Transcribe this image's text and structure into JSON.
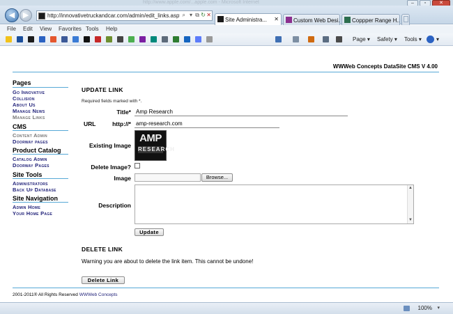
{
  "browser": {
    "faded_title": "http://www.apple.com/...apple.com - Microsoft Internet",
    "address_url": "http://innovativetruckandcar.com/admin/edit_links.asp?l",
    "tabs": [
      {
        "label": "Site Administra...",
        "active": true
      },
      {
        "label": "Custom Web Desi...",
        "active": false
      },
      {
        "label": "Coppper Range H...",
        "active": false
      }
    ],
    "menu": [
      "File",
      "Edit",
      "View",
      "Favorites",
      "Tools",
      "Help"
    ],
    "commands": {
      "page": "Page",
      "safety": "Safety",
      "tools": "Tools"
    },
    "zoom": "100%"
  },
  "header": {
    "cms_title": "WWWeb Concepts DataSite CMS V 4.00"
  },
  "sidebar": {
    "pages_heading": "Pages",
    "pages_links": [
      "Go Innovative",
      "Collision",
      "About Us",
      "Manage News",
      "Manage Links"
    ],
    "cms_heading": "CMS",
    "cms_links": [
      "Content Admin",
      "Doorway pages"
    ],
    "catalog_heading": "Product Catalog",
    "catalog_links": [
      "Catalog Admin",
      "Doorway Pages"
    ],
    "tools_heading": "Site Tools",
    "tools_links": [
      "Administrators",
      "Back Up Database"
    ],
    "nav_heading": "Site Navigation",
    "nav_links": [
      "Admin Home",
      "Your Home Page"
    ]
  },
  "form": {
    "section_title": "Update Link",
    "required_note": "Required fields marked with *.",
    "title_label": "Title*",
    "title_value": "Amp Research",
    "url_label": "URL",
    "url_prefix": "http://*",
    "url_value": "amp-research.com",
    "existing_image_label": "Existing Image",
    "logo_text_top": "AMP",
    "logo_text_bottom": "RESEARCH",
    "delete_image_label": "Delete Image?",
    "image_label": "Image",
    "browse_label": "Browse...",
    "description_label": "Description",
    "update_label": "Update"
  },
  "delete": {
    "section_title": "Delete Link",
    "warning": "Warning you are about to delete the link item. This cannot be undone!",
    "button_label": "Delete Link"
  },
  "footer": {
    "copyright": "2001-2011® All Rights Reserved",
    "link": "WWWeb Concepts"
  },
  "colors": {
    "accent_line": "#56a8d6",
    "link": "#22237a"
  }
}
